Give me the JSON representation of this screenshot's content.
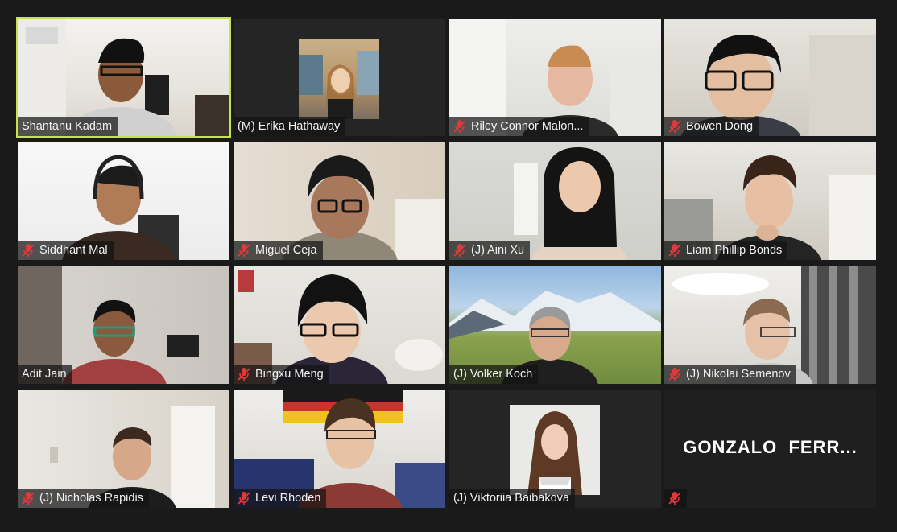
{
  "meeting": {
    "participants": [
      {
        "name": "Shantanu Kadam",
        "muted": false,
        "active_speaker": true
      },
      {
        "name": "(M) Erika Hathaway",
        "muted": false
      },
      {
        "name": "Riley Connor Malon...",
        "muted": true
      },
      {
        "name": "Bowen Dong",
        "muted": true
      },
      {
        "name": "Siddhant Mal",
        "muted": true
      },
      {
        "name": "Miguel Ceja",
        "muted": true
      },
      {
        "name": "(J) Aini Xu",
        "muted": true
      },
      {
        "name": "Liam Phillip Bonds",
        "muted": true
      },
      {
        "name": "Adit Jain",
        "muted": false
      },
      {
        "name": "Bingxu Meng",
        "muted": true
      },
      {
        "name": "(J) Volker Koch",
        "muted": false
      },
      {
        "name": "(J) Nikolai Semenov",
        "muted": true
      },
      {
        "name": "(J) Nicholas Rapidis",
        "muted": true
      },
      {
        "name": "Levi Rhoden",
        "muted": true
      },
      {
        "name": "(J) Viktoriia Baibakova",
        "muted": false
      },
      {
        "name": "",
        "muted": true,
        "video_off_label": "GONZALO  FERR..."
      }
    ]
  },
  "colors": {
    "background": "#1a1a1a",
    "active_speaker_border": "#c5e34f",
    "mute_icon": "#e0383b"
  }
}
